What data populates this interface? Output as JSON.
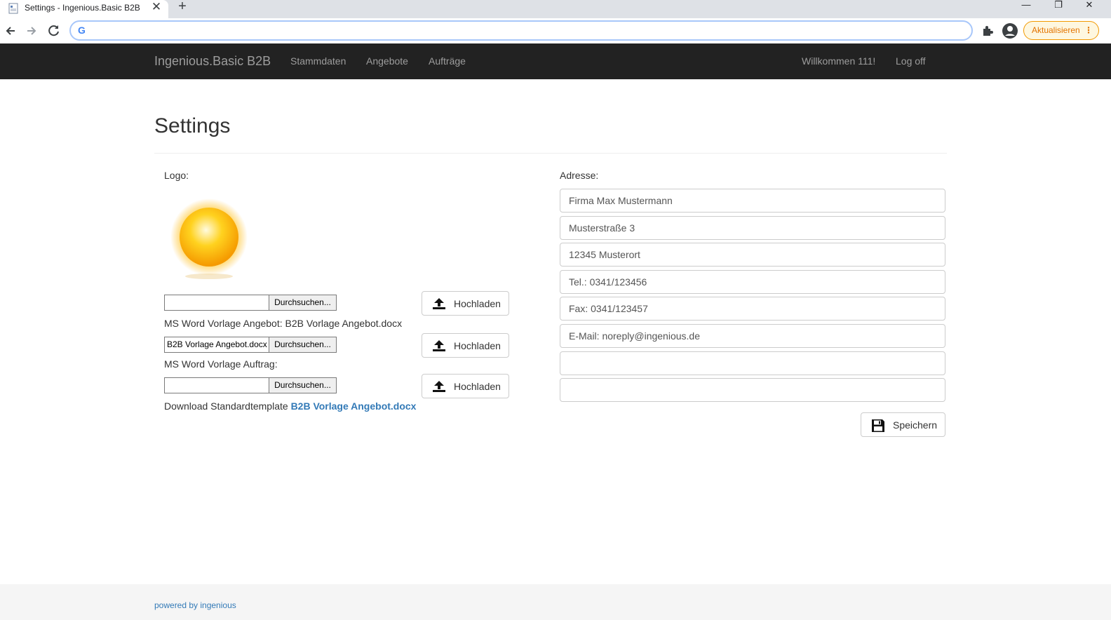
{
  "browser": {
    "tab_title": "Settings - Ingenious.Basic B2B",
    "tab_close": "✕",
    "new_tab": "+",
    "window_minimize": "—",
    "window_restore": "❐",
    "window_close": "✕",
    "address_value": "",
    "omnibox_logo": "G",
    "update_label": "Aktualisieren",
    "update_menu": "⋮"
  },
  "navbar": {
    "brand": "Ingenious.Basic B2B",
    "links": [
      "Stammdaten",
      "Angebote",
      "Aufträge"
    ],
    "welcome": "Willkommen 111!",
    "logoff": "Log off"
  },
  "page": {
    "title": "Settings",
    "logo_label": "Logo:",
    "address_label": "Adresse:"
  },
  "uploads": {
    "browse_label": "Durchsuchen...",
    "upload_label": "Hochladen",
    "logo_file": "",
    "angebot_label": "MS Word Vorlage Angebot: B2B Vorlage Angebot.docx",
    "angebot_file": "B2B Vorlage Angebot.docx",
    "auftrag_label": "MS Word Vorlage Auftrag:",
    "auftrag_file": "",
    "download_text": "Download Standardtemplate",
    "download_link": "B2B Vorlage Angebot.docx"
  },
  "address": {
    "lines": [
      "Firma Max Mustermann",
      "Musterstraße 3",
      "12345 Musterort",
      "Tel.: 0341/123456",
      "Fax: 0341/123457",
      "E-Mail: noreply@ingenious.de",
      "",
      ""
    ],
    "save_label": "Speichern"
  },
  "footer": {
    "powered_by": "powered by ingenious"
  },
  "colors": {
    "navbar_bg": "#222222",
    "navbar_text": "#9d9d9d",
    "link": "#337ab7",
    "update_accent": "#e37400"
  }
}
